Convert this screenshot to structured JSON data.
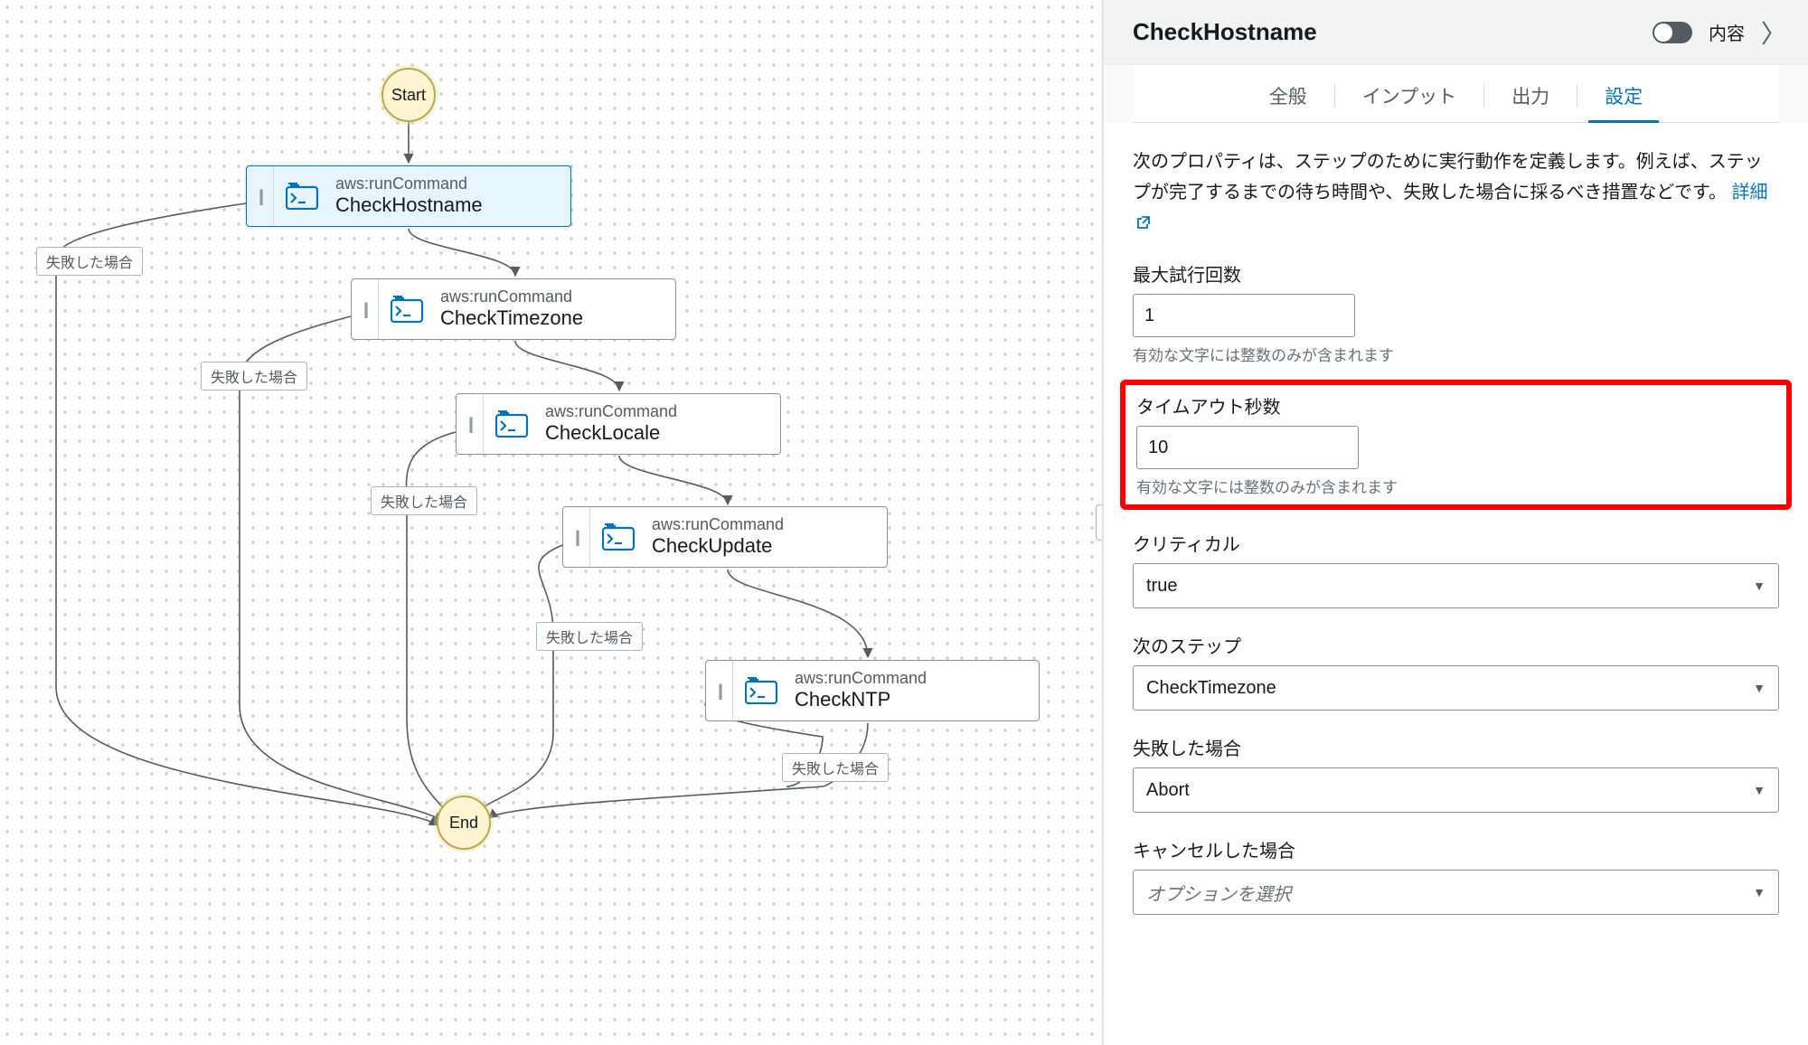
{
  "canvas": {
    "start": "Start",
    "end": "End",
    "failLabel": "失敗した場合",
    "action": "aws:runCommand",
    "nodes": {
      "hostname": "CheckHostname",
      "timezone": "CheckTimezone",
      "locale": "CheckLocale",
      "update": "CheckUpdate",
      "ntp": "CheckNTP"
    }
  },
  "panel": {
    "title": "CheckHostname",
    "toggleLabel": "内容",
    "tabs": {
      "general": "全般",
      "input": "インプット",
      "output": "出力",
      "settings": "設定"
    },
    "desc_a": "次のプロパティは、ステップのために実行動作を定義します。例えば、ステップが完了するまでの待ち時間や、失敗した場合に採るべき措置などです。",
    "desc_link": "詳細",
    "fields": {
      "maxAttempts": {
        "label": "最大試行回数",
        "value": "1",
        "helper": "有効な文字には整数のみが含まれます"
      },
      "timeout": {
        "label": "タイムアウト秒数",
        "value": "10",
        "helper": "有効な文字には整数のみが含まれます"
      },
      "critical": {
        "label": "クリティカル",
        "value": "true"
      },
      "nextStep": {
        "label": "次のステップ",
        "value": "CheckTimezone"
      },
      "onFailure": {
        "label": "失敗した場合",
        "value": "Abort"
      },
      "onCancel": {
        "label": "キャンセルした場合",
        "placeholder": "オプションを選択"
      }
    }
  }
}
